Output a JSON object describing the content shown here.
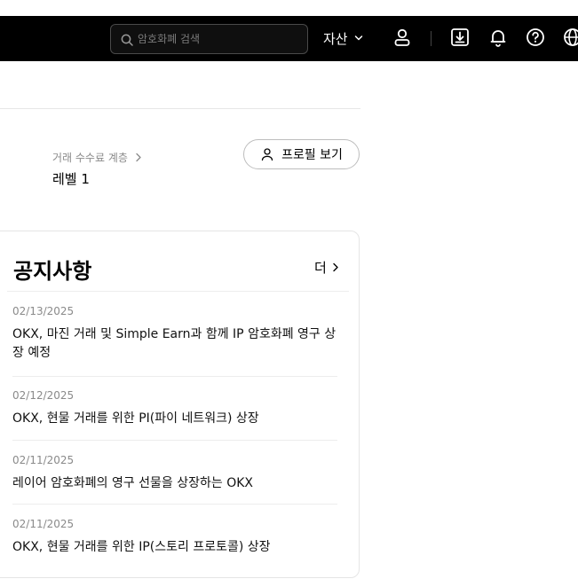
{
  "header": {
    "search_placeholder": "암호화폐 검색",
    "assets_label": "자산",
    "icons": [
      "search-icon",
      "chevron-down-icon",
      "user-icon",
      "download-icon",
      "bell-icon",
      "help-icon",
      "globe-icon"
    ]
  },
  "account": {
    "fee_tier_label": "거래 수수료 계층",
    "level": "레벨 1",
    "profile_button": "프로필 보기"
  },
  "notices": {
    "title": "공지사항",
    "more_label": "더",
    "items": [
      {
        "date": "02/13/2025",
        "title": "OKX, 마진 거래 및 Simple Earn과 함께 IP 암호화폐 영구 상장 예정"
      },
      {
        "date": "02/12/2025",
        "title": "OKX, 현물 거래를 위한 PI(파이 네트워크) 상장"
      },
      {
        "date": "02/11/2025",
        "title": "레이어 암호화폐의 영구 선물을 상장하는 OKX"
      },
      {
        "date": "02/11/2025",
        "title": "OKX, 현물 거래를 위한 IP(스토리 프로토콜) 상장"
      }
    ]
  },
  "colors": {
    "topbar_bg": "#000000",
    "muted_text": "#8a8a8a",
    "border": "#e5e5e5"
  }
}
